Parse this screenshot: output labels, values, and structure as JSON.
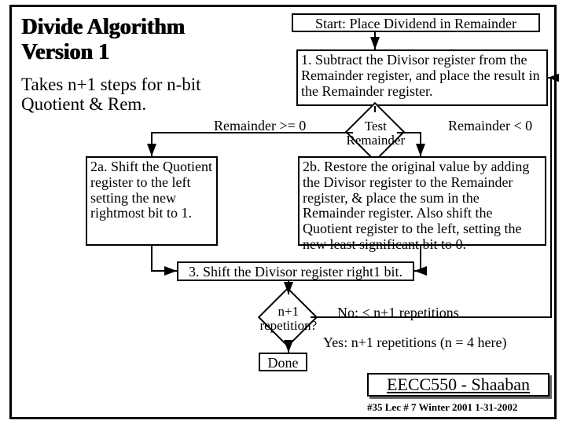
{
  "title": "Divide Algorithm\nVersion 1",
  "subtitle": "Takes n+1 steps for n-bit\nQuotient & Rem.",
  "start": "Start: Place Dividend in Remainder",
  "step1": "1. Subtract the Divisor register from the Remainder register, and place the result in the Remainder register.",
  "test": "Test Remainder",
  "label_ge0": "Remainder >= 0",
  "label_lt0": "Remainder < 0",
  "step2a": "2a. Shift the Quotient register to the left setting the new rightmost bit to 1.",
  "step2b": "2b. Restore the original value by adding the Divisor register to the Remainder register, & place the sum in the Remainder register. Also shift the Quotient register to the left, setting the new least significant bit to 0.",
  "step3": "3. Shift the Divisor register right1 bit.",
  "rep": "n+1 repetition?",
  "label_no": "No: < n+1 repetitions",
  "label_yes": "Yes: n+1 repetitions (n = 4 here)",
  "done": "Done",
  "footer": "EECC550 - Shaaban",
  "footer_sub": "#35   Lec # 7   Winter 2001   1-31-2002",
  "chart_data": {
    "type": "flowchart",
    "nodes": [
      {
        "id": "start",
        "shape": "rect",
        "text": "Start: Place Dividend in Remainder"
      },
      {
        "id": "s1",
        "shape": "rect",
        "text": "1. Subtract the Divisor register from the Remainder register, and place the result in the Remainder register."
      },
      {
        "id": "test",
        "shape": "diamond",
        "text": "Test Remainder"
      },
      {
        "id": "s2a",
        "shape": "rect",
        "text": "2a. Shift the Quotient register to the left setting the new rightmost bit to 1."
      },
      {
        "id": "s2b",
        "shape": "rect",
        "text": "2b. Restore the original value by adding the Divisor register to the Remainder register, & place the sum in the Remainder register. Also shift the Quotient register to the left, setting the new least significant bit to 0."
      },
      {
        "id": "s3",
        "shape": "rect",
        "text": "3. Shift the Divisor register right 1 bit."
      },
      {
        "id": "rep",
        "shape": "diamond",
        "text": "n+1 repetition?"
      },
      {
        "id": "done",
        "shape": "rect",
        "text": "Done"
      }
    ],
    "edges": [
      {
        "from": "start",
        "to": "s1"
      },
      {
        "from": "s1",
        "to": "test"
      },
      {
        "from": "test",
        "to": "s2a",
        "label": "Remainder >= 0"
      },
      {
        "from": "test",
        "to": "s2b",
        "label": "Remainder < 0"
      },
      {
        "from": "s2a",
        "to": "s3"
      },
      {
        "from": "s2b",
        "to": "s3"
      },
      {
        "from": "s3",
        "to": "rep"
      },
      {
        "from": "rep",
        "to": "s1",
        "label": "No: < n+1 repetitions"
      },
      {
        "from": "rep",
        "to": "done",
        "label": "Yes: n+1 repetitions (n = 4 here)"
      }
    ]
  }
}
